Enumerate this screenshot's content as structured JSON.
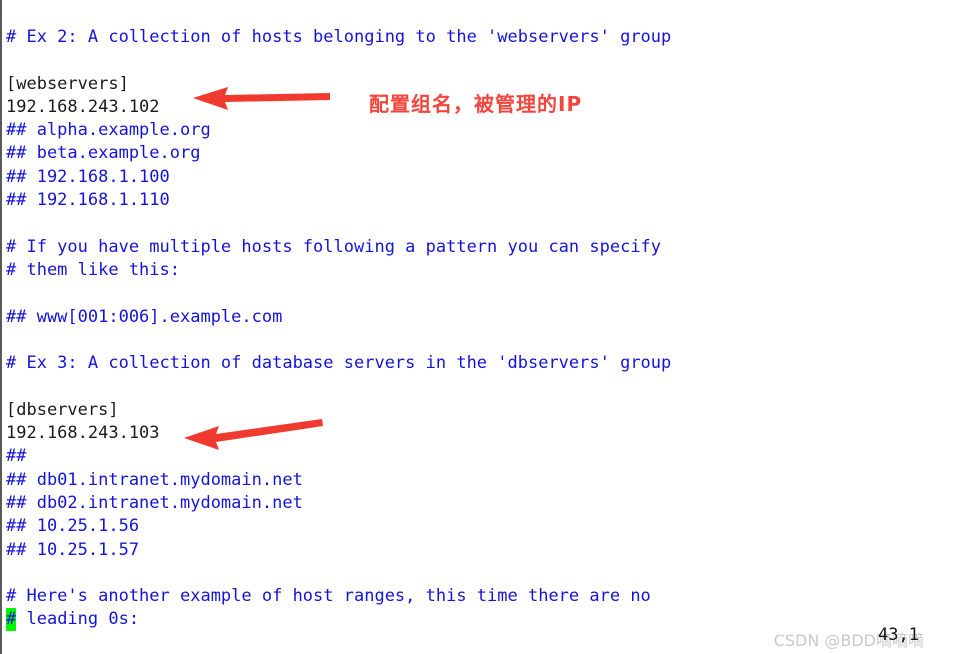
{
  "window": {
    "app": "vim",
    "colors": {
      "background": "#ffffff",
      "comment_blue": "#1414d7",
      "plain_black": "#1a1a1a",
      "cursor_green": "#00f700",
      "annotation_red": "#f4453c",
      "watermark_gray": "#c9c9c9",
      "left_rule": "#5a5a5a"
    }
  },
  "editor": {
    "lines": [
      {
        "text": "# Ex 2: A collection of hosts belonging to the 'webservers' group",
        "style": "comment"
      },
      {
        "text": "",
        "style": "blank"
      },
      {
        "text": "[webservers]",
        "style": "plain"
      },
      {
        "text": "192.168.243.102",
        "style": "plain"
      },
      {
        "text": "## alpha.example.org",
        "style": "comment"
      },
      {
        "text": "## beta.example.org",
        "style": "comment"
      },
      {
        "text": "## 192.168.1.100",
        "style": "comment"
      },
      {
        "text": "## 192.168.1.110",
        "style": "comment"
      },
      {
        "text": "",
        "style": "blank"
      },
      {
        "text": "# If you have multiple hosts following a pattern you can specify",
        "style": "comment"
      },
      {
        "text": "# them like this:",
        "style": "comment"
      },
      {
        "text": "",
        "style": "blank"
      },
      {
        "text": "## www[001:006].example.com",
        "style": "comment"
      },
      {
        "text": "",
        "style": "blank"
      },
      {
        "text": "# Ex 3: A collection of database servers in the 'dbservers' group",
        "style": "comment"
      },
      {
        "text": "",
        "style": "blank"
      },
      {
        "text": "[dbservers]",
        "style": "plain"
      },
      {
        "text": "192.168.243.103",
        "style": "plain"
      },
      {
        "text": "##",
        "style": "comment"
      },
      {
        "text": "## db01.intranet.mydomain.net",
        "style": "comment"
      },
      {
        "text": "## db02.intranet.mydomain.net",
        "style": "comment"
      },
      {
        "text": "## 10.25.1.56",
        "style": "comment"
      },
      {
        "text": "## 10.25.1.57",
        "style": "comment"
      },
      {
        "text": "",
        "style": "blank"
      },
      {
        "text": "# Here's another example of host ranges, this time there are no",
        "style": "comment"
      },
      {
        "text": "# leading 0s:",
        "style": "comment",
        "cursor_at": 0
      }
    ]
  },
  "annotations": {
    "notes": [
      {
        "id": "note-1",
        "text": "配置组名，被管理的IP"
      }
    ],
    "arrows": [
      {
        "id": "arrow-webservers",
        "points_to": "192.168.243.102"
      },
      {
        "id": "arrow-dbservers",
        "points_to": "192.168.243.103"
      }
    ]
  },
  "status": {
    "cursor_position": "43,1",
    "watermark": "CSDN @BDD嘀嘀嘀"
  }
}
